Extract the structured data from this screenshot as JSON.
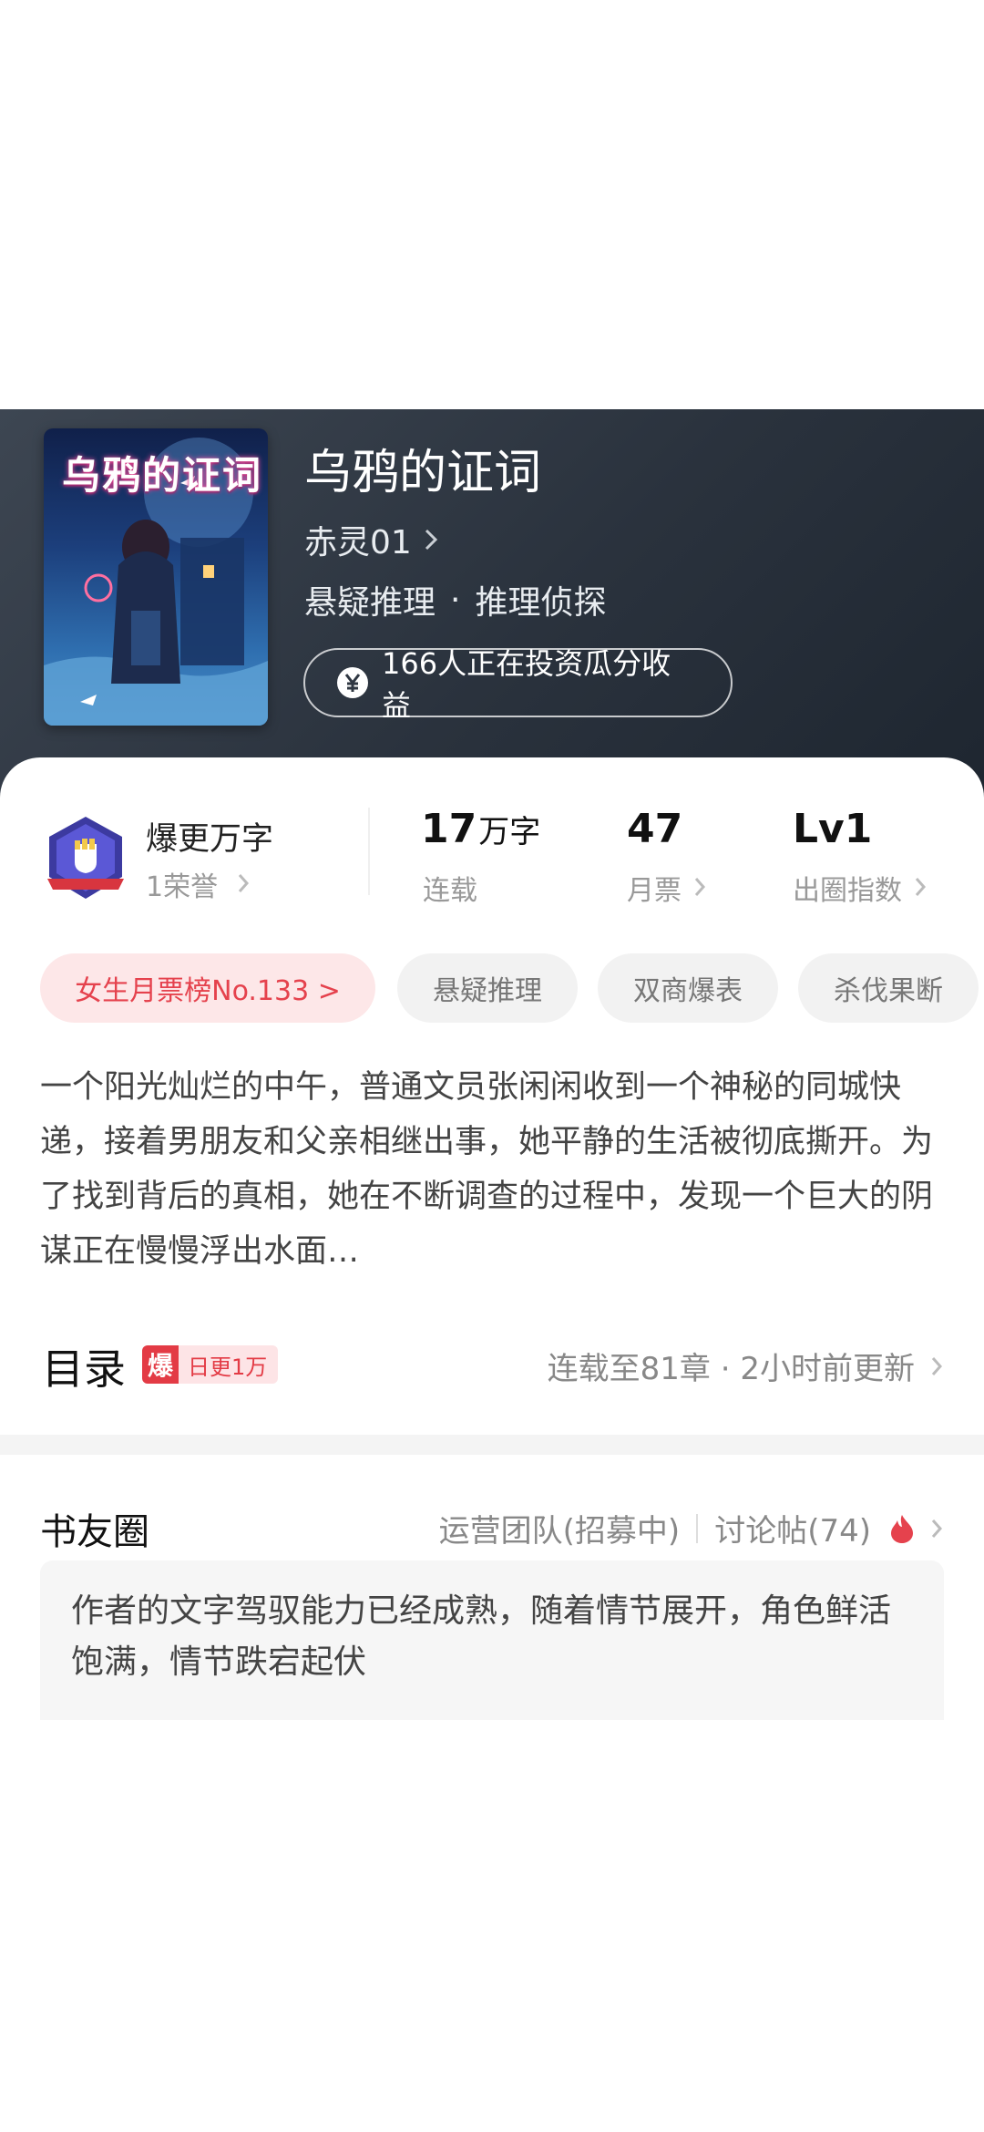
{
  "book": {
    "title": "乌鸦的证词",
    "cover_title": "乌鸦的证词",
    "author": "赤灵01",
    "genre_main": "悬疑推理",
    "genre_sub": "推理侦探",
    "genre_separator": "·",
    "invest_text": "166人正在投资瓜分收益"
  },
  "stats": {
    "honor_title": "爆更万字",
    "honor_sub": "1荣誉",
    "words_value": "17",
    "words_unit": "万字",
    "words_label": "连载",
    "monthly_votes_value": "47",
    "monthly_votes_label": "月票",
    "level_value": "Lv1",
    "level_label": "出圈指数"
  },
  "tags": [
    {
      "label": "女生月票榜No.133 >"
    },
    {
      "label": "悬疑推理"
    },
    {
      "label": "双商爆表"
    },
    {
      "label": "杀伐果断"
    }
  ],
  "synopsis": "一个阳光灿烂的中午，普通文员张闲闲收到一个神秘的同城快递，接着男朋友和父亲相继出事，她平静的生活被彻底撕开。为了找到背后的真相，她在不断调查的过程中，发现一个巨大的阴谋正在慢慢浮出水面…",
  "catalog": {
    "title": "目录",
    "badge_icon": "爆",
    "badge_text": "日更1万",
    "status": "连载至81章 · 2小时前更新"
  },
  "friends": {
    "title": "书友圈",
    "ops_link": "运营团队(招募中)",
    "discussion_link": "讨论帖(74)",
    "comment": "作者的文字驾驭能力已经成熟，随着情节展开，角色鲜活饱满，情节跌宕起伏"
  },
  "colors": {
    "header_bg": "#2f3742",
    "accent_red": "#e5424d",
    "hot_tag_bg": "#fde7e8",
    "tag_bg": "#f2f2f2"
  },
  "icons": {
    "author_chevron": "chevron-right-icon",
    "invest": "yen-coin-icon",
    "honor_badge": "fist-shield-badge-icon",
    "hot": "flame-icon"
  }
}
